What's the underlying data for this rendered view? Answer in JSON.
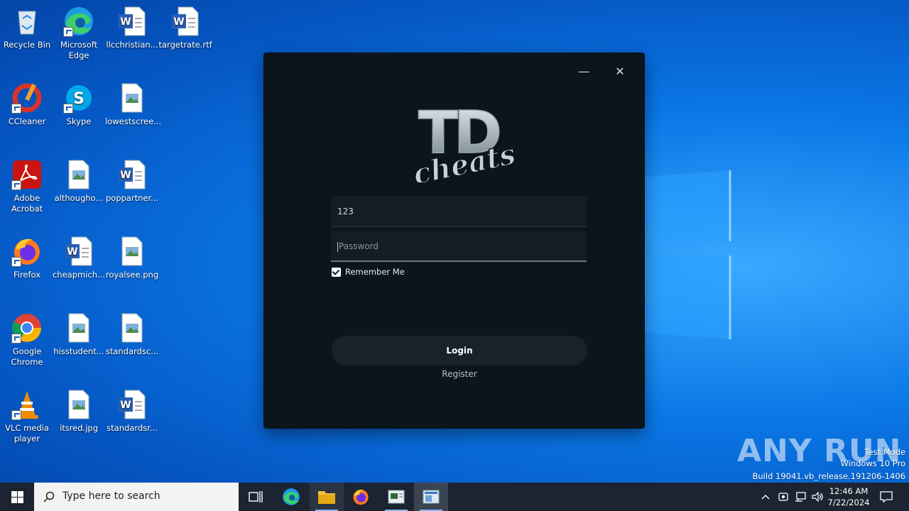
{
  "desktop": {
    "icons": [
      {
        "label": "Recycle Bin",
        "icon": "recycle-bin-icon"
      },
      {
        "label": "Microsoft Edge",
        "icon": "edge-icon"
      },
      {
        "label": "llcchristian...",
        "icon": "word-doc-icon"
      },
      {
        "label": "targetrate.rtf",
        "icon": "word-doc-icon"
      },
      {
        "label": "CCleaner",
        "icon": "ccleaner-icon"
      },
      {
        "label": "Skype",
        "icon": "skype-icon"
      },
      {
        "label": "lowestscree...",
        "icon": "image-file-icon"
      },
      {
        "label": "Adobe Acrobat",
        "icon": "acrobat-icon"
      },
      {
        "label": "althougho...",
        "icon": "image-file-icon"
      },
      {
        "label": "poppartner...",
        "icon": "word-doc-icon"
      },
      {
        "label": "Firefox",
        "icon": "firefox-icon"
      },
      {
        "label": "cheapmich...",
        "icon": "word-doc-icon"
      },
      {
        "label": "royalsee.png",
        "icon": "image-file-icon"
      },
      {
        "label": "Google Chrome",
        "icon": "chrome-icon"
      },
      {
        "label": "hisstudent...",
        "icon": "image-file-icon"
      },
      {
        "label": "standardsc...",
        "icon": "image-file-icon"
      },
      {
        "label": "VLC media player",
        "icon": "vlc-icon"
      },
      {
        "label": "itsred.jpg",
        "icon": "image-file-icon"
      },
      {
        "label": "standardsr...",
        "icon": "word-doc-icon"
      }
    ]
  },
  "dialog": {
    "minimize": "—",
    "close": "✕",
    "logo_text_top": "TD",
    "logo_text_bottom": "cheats",
    "username_value": "123",
    "password_placeholder": "Password",
    "remember_label": "Remember Me",
    "remember_checked": true,
    "login_label": "Login",
    "register_label": "Register"
  },
  "watermark": {
    "brand": "ANY RUN",
    "test_mode": "Test Mode",
    "edition": "Windows 10 Pro",
    "build": "Build 19041.vb_release.191206-1406"
  },
  "taskbar": {
    "search_placeholder": "Type here to search",
    "time": "12:46 AM",
    "date": "7/22/2024"
  },
  "colors": {
    "desktop_bg": "#0a78e6",
    "dialog_bg": "#0c151c",
    "taskbar_bg": "#1b2430"
  }
}
